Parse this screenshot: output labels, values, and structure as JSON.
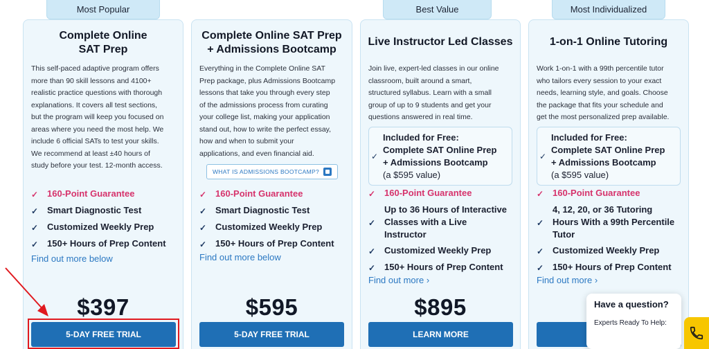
{
  "badges": [
    "Most Popular",
    "Best Value",
    "Most Individualized"
  ],
  "cards": [
    {
      "title_lines": [
        "Complete Online",
        "SAT Prep"
      ],
      "description_lines": [
        "This self-paced adaptive program offers",
        "more than 90 skill lessons and 4100+",
        "realistic practice questions with thorough",
        "explanations. It covers all test sections,",
        "but the program will keep you focused on",
        "areas where you need the most help. We",
        "include 6 official SATs to test your skills.",
        "We recommend at least ±40 hours of",
        "study before your test. 12-month access."
      ],
      "features": [
        {
          "lines": [
            "160-Point Guarantee"
          ],
          "pink": true
        },
        {
          "lines": [
            "Smart Diagnostic Test"
          ]
        },
        {
          "lines": [
            "Customized Weekly Prep"
          ]
        },
        {
          "lines": [
            "150+ Hours of Prep Content"
          ]
        }
      ],
      "link": "Find out more below",
      "price": "$397",
      "cta": "5-DAY FREE TRIAL"
    },
    {
      "title_lines": [
        "Complete Online SAT Prep",
        "+ Admissions Bootcamp"
      ],
      "description_lines": [
        "Everything in the Complete Online SAT",
        "Prep package, plus Admissions Bootcamp",
        "lessons that take you through every step",
        "of the admissions process from curating",
        "your college list, making your application",
        "stand out, how to write the perfect essay,",
        "how and when to submit your",
        "applications, and even financial aid."
      ],
      "bootcamp_button": "WHAT IS ADMISSIONS BOOTCAMP?",
      "features": [
        {
          "lines": [
            "160-Point Guarantee"
          ],
          "pink": true
        },
        {
          "lines": [
            "Smart Diagnostic Test"
          ]
        },
        {
          "lines": [
            "Customized Weekly Prep"
          ]
        },
        {
          "lines": [
            "150+ Hours of Prep Content"
          ]
        }
      ],
      "link": "Find out more below",
      "price": "$595",
      "cta": "5-DAY FREE TRIAL"
    },
    {
      "title_lines": [
        "Live Instructor Led Classes"
      ],
      "description_lines": [
        "Join live, expert-led classes in our online",
        "classroom, built around a smart,",
        "structured syllabus. Learn with a small",
        "group of up to 9 students and get your",
        "questions answered in real time."
      ],
      "free_box": {
        "heading": "Included for Free:",
        "line1": "Complete SAT Online Prep",
        "line2": "+ Admissions Bootcamp",
        "value": "(a $595 value)"
      },
      "features": [
        {
          "lines": [
            "160-Point Guarantee"
          ],
          "pink": true
        },
        {
          "lines": [
            "Up to 36 Hours of Interactive",
            "Classes with a Live",
            "Instructor"
          ]
        },
        {
          "lines": [
            "Customized Weekly Prep"
          ]
        },
        {
          "lines": [
            "150+ Hours of Prep Content"
          ]
        }
      ],
      "link": "Find out more ›",
      "price": "$895",
      "cta": "LEARN MORE"
    },
    {
      "title_lines": [
        "1-on-1 Online Tutoring"
      ],
      "description_lines": [
        "Work 1-on-1 with a 99th percentile tutor",
        "who tailors every session to your exact",
        "needs, learning style, and goals. Choose",
        "the package that fits your schedule and",
        "get the most personalized prep available."
      ],
      "free_box": {
        "heading": "Included for Free:",
        "line1": "Complete SAT Online Prep",
        "line2": "+ Admissions Bootcamp",
        "value": "(a $595 value)"
      },
      "features": [
        {
          "lines": [
            "160-Point Guarantee"
          ],
          "pink": true
        },
        {
          "lines": [
            "4, 12, 20, or 36 Tutoring",
            "Hours With a 99th Percentile",
            "Tutor"
          ]
        },
        {
          "lines": [
            "Customized Weekly Prep"
          ]
        },
        {
          "lines": [
            "150+ Hours of Prep Content"
          ]
        }
      ],
      "link": "Find out more ›",
      "price": "",
      "cta": ""
    }
  ],
  "chat": {
    "title": "Have a question?",
    "subtitle": "Experts Ready To Help:"
  },
  "colors": {
    "accent": "#1f6fb5",
    "pink": "#d6336c",
    "highlight": "#e0191f",
    "phone": "#f7c600"
  }
}
